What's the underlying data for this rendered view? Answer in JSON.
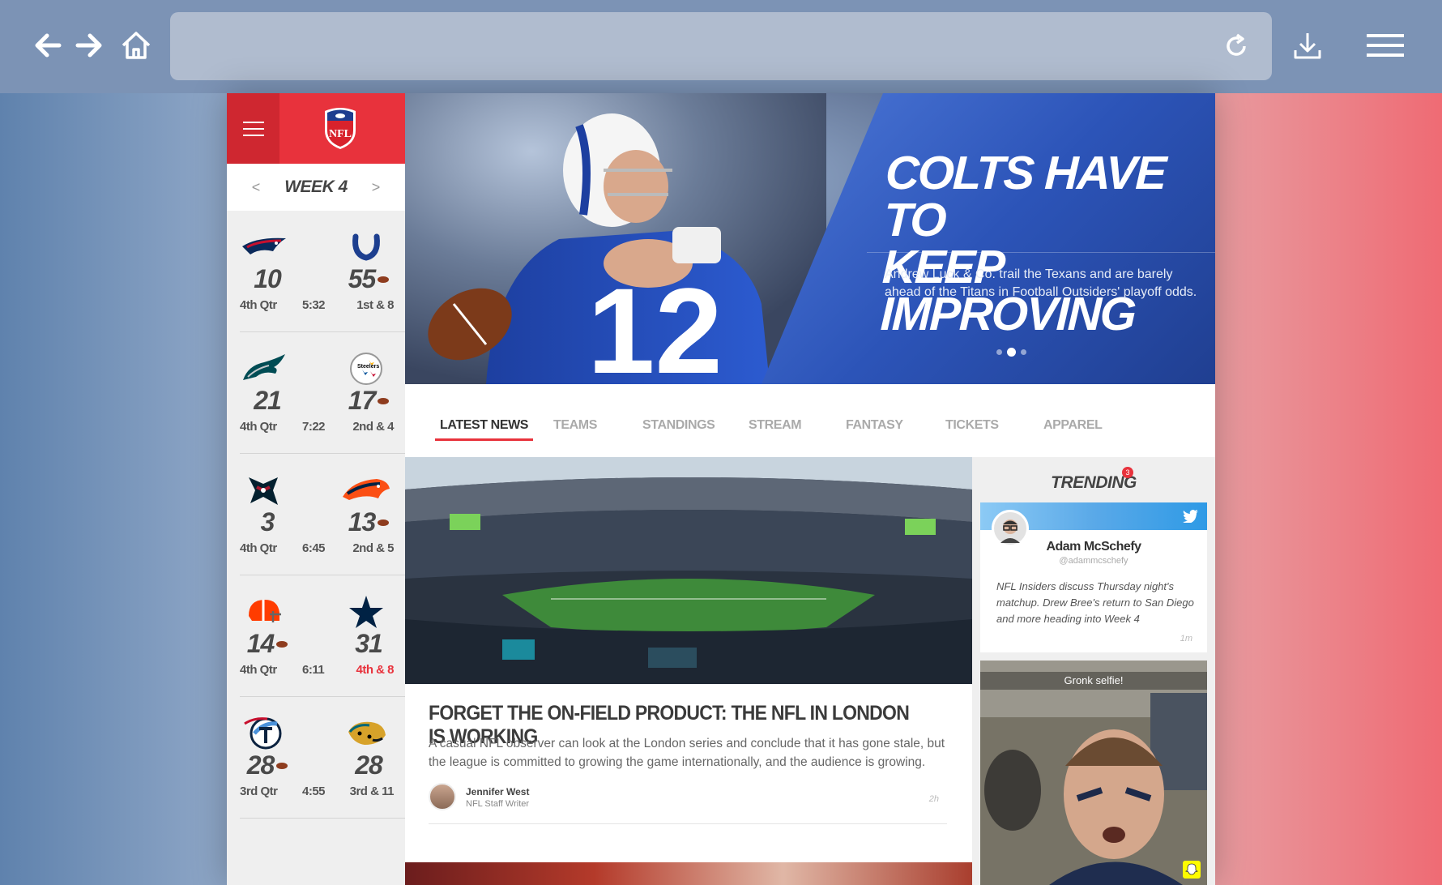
{
  "browser": {
    "back_icon": "arrow-left-icon",
    "forward_icon": "arrow-right-icon",
    "home_icon": "home-icon",
    "reload_icon": "reload-icon",
    "download_icon": "download-icon",
    "menu_icon": "hamburger-menu-icon",
    "url": ""
  },
  "sidebar": {
    "week_label": "WEEK 4",
    "prev": "<",
    "next": ">",
    "games": [
      {
        "home": {
          "team": "patriots",
          "score": "10",
          "possession": false
        },
        "away": {
          "team": "colts",
          "score": "55",
          "possession": true
        },
        "quarter": "4th Qtr",
        "clock": "5:32",
        "down": "1st & 8",
        "down_alert": false
      },
      {
        "home": {
          "team": "eagles",
          "score": "21",
          "possession": false
        },
        "away": {
          "team": "steelers",
          "score": "17",
          "possession": true
        },
        "quarter": "4th Qtr",
        "clock": "7:22",
        "down": "2nd & 4",
        "down_alert": false
      },
      {
        "home": {
          "team": "texans",
          "score": "3",
          "possession": false
        },
        "away": {
          "team": "broncos",
          "score": "13",
          "possession": true
        },
        "quarter": "4th Qtr",
        "clock": "6:45",
        "down": "2nd & 5",
        "down_alert": false
      },
      {
        "home": {
          "team": "browns",
          "score": "14",
          "possession": true
        },
        "away": {
          "team": "cowboys",
          "score": "31",
          "possession": false
        },
        "quarter": "4th Qtr",
        "clock": "6:11",
        "down": "4th & 8",
        "down_alert": true
      },
      {
        "home": {
          "team": "titans",
          "score": "28",
          "possession": true
        },
        "away": {
          "team": "jaguars",
          "score": "28",
          "possession": false
        },
        "quarter": "3rd Qtr",
        "clock": "4:55",
        "down": "3rd & 11",
        "down_alert": false
      }
    ]
  },
  "hero": {
    "title_line1": "COLTS HAVE TO",
    "title_line2": "KEEP IMPROVING",
    "subtitle": "Andrew Luck & Co. trail the Texans and are barely ahead of the Titans in Football Outsiders' playoff odds.",
    "slide_count": 3,
    "active_slide": 2
  },
  "tabs": [
    "LATEST NEWS",
    "TEAMS",
    "STANDINGS",
    "STREAM",
    "FANTASY",
    "TICKETS",
    "APPAREL"
  ],
  "article": {
    "title": "FORGET THE ON-FIELD PRODUCT: THE NFL IN LONDON IS WORKING",
    "body": "A casual NFL observer can look at the London series and conclude that it has gone stale, but the league is committed to growing the game internationally, and the audience is growing.",
    "author": "Jennifer West",
    "role": "NFL Staff Writer",
    "time": "2h"
  },
  "trending": {
    "title": "TRENDING",
    "badge": "3",
    "tweet": {
      "name": "Adam McSchefy",
      "handle": "@adammcschefy",
      "text": "NFL Insiders discuss Thursday night's matchup. Drew Bree's return to San Diego and more heading into Week 4",
      "time": "1m"
    },
    "snap": {
      "caption": "Gronk selfie!"
    }
  },
  "colors": {
    "nfl_red": "#e8323c",
    "nfl_blue": "#2c54b8",
    "twitter_blue": "#2e9ae6"
  }
}
